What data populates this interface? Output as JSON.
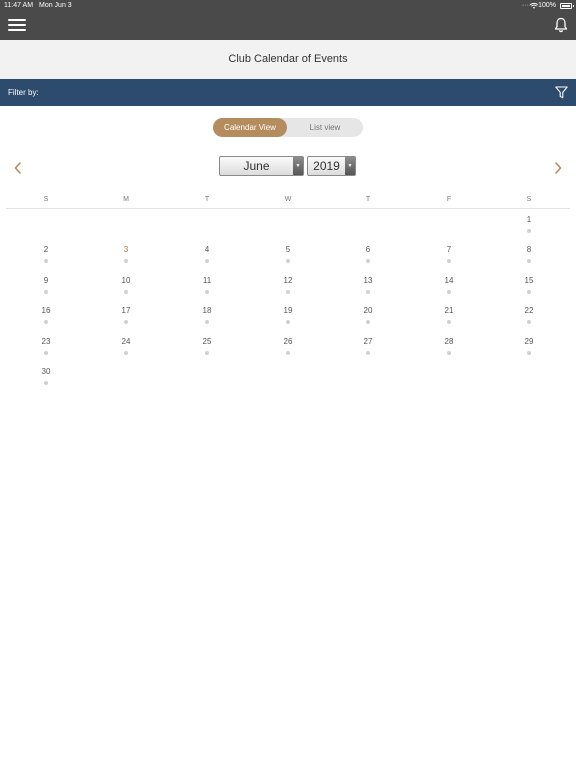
{
  "status_bar": {
    "time": "11:47 AM",
    "date": "Mon Jun 3",
    "signal_dots": "·····",
    "battery": "100%"
  },
  "nav": {
    "menu_icon": "hamburger-menu-icon",
    "bell_icon": "bell-icon"
  },
  "page_title": "Club Calendar of Events",
  "filter": {
    "label": "Filter by:",
    "icon": "funnel-icon",
    "bar_color": "#2c4b6d"
  },
  "view_toggle": {
    "calendar_label": "Calendar View",
    "list_label": "List view",
    "active": "Calendar View",
    "accent_color": "#b58c5e"
  },
  "calendar": {
    "month": "June",
    "year": "2019",
    "weekdays": [
      "S",
      "M",
      "T",
      "W",
      "T",
      "F",
      "S"
    ],
    "first_weekday_index": 6,
    "days_in_month": 30,
    "today": 3,
    "today_color": "#b5763a"
  }
}
